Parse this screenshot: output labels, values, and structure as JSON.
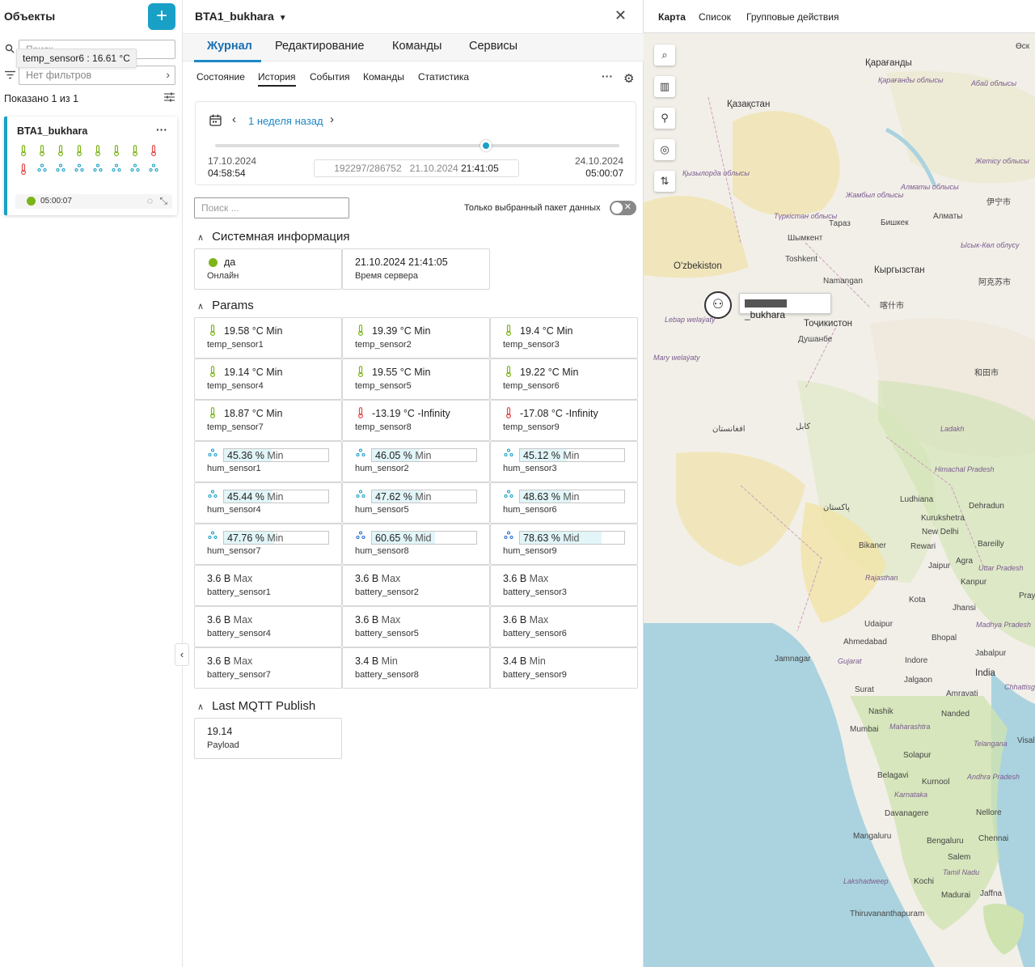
{
  "left": {
    "title": "Объекты",
    "add_label": "+",
    "search_placeholder": "Поиск",
    "tooltip": "temp_sensor6 : 16.61 °C",
    "filter_label": "Нет фильтров",
    "shown_text": "Показано 1 из 1",
    "card": {
      "title": "BTA1_bukhara",
      "more": "···",
      "row1": [
        {
          "icon": "thermometer-icon",
          "status": "ok"
        },
        {
          "icon": "thermometer-icon",
          "status": "ok"
        },
        {
          "icon": "thermometer-icon",
          "status": "ok"
        },
        {
          "icon": "thermometer-icon",
          "status": "ok"
        },
        {
          "icon": "thermometer-icon",
          "status": "ok"
        },
        {
          "icon": "thermometer-icon",
          "status": "ok"
        },
        {
          "icon": "thermometer-icon",
          "status": "ok"
        },
        {
          "icon": "thermometer-icon",
          "status": "alert"
        }
      ],
      "row2": [
        {
          "icon": "thermometer-icon",
          "status": "alert"
        },
        {
          "icon": "humidity-icon",
          "status": "ok"
        },
        {
          "icon": "humidity-icon",
          "status": "ok"
        },
        {
          "icon": "humidity-icon",
          "status": "ok"
        },
        {
          "icon": "humidity-icon",
          "status": "ok"
        },
        {
          "icon": "humidity-icon",
          "status": "ok"
        },
        {
          "icon": "humidity-icon",
          "status": "ok"
        },
        {
          "icon": "humidity-icon",
          "status": "ok"
        }
      ],
      "time": "05:00:07"
    }
  },
  "mid": {
    "title": "BTA1_bukhara",
    "tabs": [
      "Журнал",
      "Редактирование",
      "Команды",
      "Сервисы"
    ],
    "active_tab": "Журнал",
    "subtabs": [
      "Состояние",
      "История",
      "События",
      "Команды",
      "Статистика"
    ],
    "active_subtab": "История",
    "period": {
      "label": "1 неделя назад",
      "start_date": "17.10.2024",
      "start_time": "04:58:54",
      "end_date": "24.10.2024",
      "end_time": "05:00:07",
      "counter": "192297/286752",
      "current_date": "21.10.2024",
      "current_time": "21:41:05",
      "slider_position": 0.67
    },
    "search_placeholder": "Поиск ...",
    "only_selected_label": "Только выбранный пакет данных",
    "sections": {
      "system": {
        "title": "Системная информация",
        "cells": [
          {
            "value": "да",
            "name": "Онлайн"
          },
          {
            "value": "21.10.2024 21:41:05",
            "name": "Время сервера"
          }
        ]
      },
      "params": {
        "title": "Params",
        "temps": [
          {
            "value": "19.58 °C",
            "tag": "Min",
            "name": "temp_sensor1",
            "status": "ok"
          },
          {
            "value": "19.39 °C",
            "tag": "Min",
            "name": "temp_sensor2",
            "status": "ok"
          },
          {
            "value": "19.4 °C",
            "tag": "Min",
            "name": "temp_sensor3",
            "status": "ok"
          },
          {
            "value": "19.14 °C",
            "tag": "Min",
            "name": "temp_sensor4",
            "status": "ok"
          },
          {
            "value": "19.55 °C",
            "tag": "Min",
            "name": "temp_sensor5",
            "status": "ok"
          },
          {
            "value": "19.22 °C",
            "tag": "Min",
            "name": "temp_sensor6",
            "status": "ok"
          },
          {
            "value": "18.87 °C",
            "tag": "Min",
            "name": "temp_sensor7",
            "status": "ok"
          },
          {
            "value": "-13.19 °C",
            "tag": "-Infinity",
            "name": "temp_sensor8",
            "status": "alert"
          },
          {
            "value": "-17.08 °C",
            "tag": "-Infinity",
            "name": "temp_sensor9",
            "status": "alert"
          }
        ],
        "hums": [
          {
            "value": "45.36 %",
            "tag": "Min",
            "name": "hum_sensor1",
            "level": 0.4536,
            "color": "#19a0c6"
          },
          {
            "value": "46.05 %",
            "tag": "Min",
            "name": "hum_sensor2",
            "level": 0.4605,
            "color": "#19a0c6"
          },
          {
            "value": "45.12 %",
            "tag": "Min",
            "name": "hum_sensor3",
            "level": 0.4512,
            "color": "#19a0c6"
          },
          {
            "value": "45.44 %",
            "tag": "Min",
            "name": "hum_sensor4",
            "level": 0.4544,
            "color": "#19a0c6"
          },
          {
            "value": "47.62 %",
            "tag": "Min",
            "name": "hum_sensor5",
            "level": 0.4762,
            "color": "#19a0c6"
          },
          {
            "value": "48.63 %",
            "tag": "Min",
            "name": "hum_sensor6",
            "level": 0.4863,
            "color": "#19a0c6"
          },
          {
            "value": "47.76 %",
            "tag": "Min",
            "name": "hum_sensor7",
            "level": 0.4776,
            "color": "#19a0c6"
          },
          {
            "value": "60.65 %",
            "tag": "Mid",
            "name": "hum_sensor8",
            "level": 0.6065,
            "color": "#2a6fd0"
          },
          {
            "value": "78.63 %",
            "tag": "Mid",
            "name": "hum_sensor9",
            "level": 0.7863,
            "color": "#2a6fd0"
          }
        ],
        "batteries": [
          {
            "value": "3.6 В",
            "tag": "Max",
            "name": "battery_sensor1"
          },
          {
            "value": "3.6 В",
            "tag": "Max",
            "name": "battery_sensor2"
          },
          {
            "value": "3.6 В",
            "tag": "Max",
            "name": "battery_sensor3"
          },
          {
            "value": "3.6 В",
            "tag": "Max",
            "name": "battery_sensor4"
          },
          {
            "value": "3.6 В",
            "tag": "Max",
            "name": "battery_sensor5"
          },
          {
            "value": "3.6 В",
            "tag": "Max",
            "name": "battery_sensor6"
          },
          {
            "value": "3.6 В",
            "tag": "Max",
            "name": "battery_sensor7"
          },
          {
            "value": "3.4 В",
            "tag": "Min",
            "name": "battery_sensor8"
          },
          {
            "value": "3.4 В",
            "tag": "Min",
            "name": "battery_sensor9"
          }
        ]
      },
      "mqtt": {
        "title": "Last MQTT Publish",
        "cells": [
          {
            "value": "19.14",
            "name": "Payload"
          }
        ]
      }
    }
  },
  "map": {
    "tabs": [
      "Карта",
      "Список",
      "Групповые действия"
    ],
    "active_tab": "Карта",
    "controls": [
      "search-icon",
      "map-icon",
      "pin-icon",
      "locate-icon",
      "route-icon"
    ],
    "marker_label_suffix": "_bukhara",
    "places": [
      {
        "text": "Қарағанды"
      },
      {
        "text": "Қазақстан"
      },
      {
        "text": "Қарағанды облысы"
      },
      {
        "text": "Абай облысы"
      },
      {
        "text": "Жетісу облысы"
      },
      {
        "text": "Қызылорда облысы"
      },
      {
        "text": "Жамбыл облысы"
      },
      {
        "text": "Алматы облысы"
      },
      {
        "text": "Түркістан облысы"
      },
      {
        "text": "Тараз"
      },
      {
        "text": "Бишкек"
      },
      {
        "text": "Алматы"
      },
      {
        "text": "Шымкент"
      },
      {
        "text": "Ысык-Көл облусу"
      },
      {
        "text": "Toshkent"
      },
      {
        "text": "O'zbekiston"
      },
      {
        "text": "Namangan"
      },
      {
        "text": "Кыргызстан"
      },
      {
        "text": "阿克苏市"
      },
      {
        "text": "Тоҷикистон"
      },
      {
        "text": "Душанбе"
      },
      {
        "text": "Lebap welaýaty"
      },
      {
        "text": "Mary welaýaty"
      },
      {
        "text": "喀什市"
      },
      {
        "text": "和田市"
      },
      {
        "text": "افغانستان"
      },
      {
        "text": "کابل"
      },
      {
        "text": "Ladakh"
      },
      {
        "text": "Himachal Pradesh"
      },
      {
        "text": "Ludhiana"
      },
      {
        "text": "Kurukshetra"
      },
      {
        "text": "Dehradun"
      },
      {
        "text": "New Delhi"
      },
      {
        "text": "پاکستان"
      },
      {
        "text": "Bikaner"
      },
      {
        "text": "Rewari"
      },
      {
        "text": "Bareilly"
      },
      {
        "text": "Agra"
      },
      {
        "text": "Jaipur"
      },
      {
        "text": "Uttar Pradesh"
      },
      {
        "text": "Rajasthan"
      },
      {
        "text": "Kanpur"
      },
      {
        "text": "Prayagr"
      },
      {
        "text": "Kota"
      },
      {
        "text": "Jhansi"
      },
      {
        "text": "Udaipur"
      },
      {
        "text": "Madhya Pradesh"
      },
      {
        "text": "Ahmedabad"
      },
      {
        "text": "Bhopal"
      },
      {
        "text": "Jamnagar"
      },
      {
        "text": "Gujarat"
      },
      {
        "text": "Indore"
      },
      {
        "text": "Jabalpur"
      },
      {
        "text": "India"
      },
      {
        "text": "Jalgaon"
      },
      {
        "text": "Chhattisgar"
      },
      {
        "text": "Surat"
      },
      {
        "text": "Amravati"
      },
      {
        "text": "Nashik"
      },
      {
        "text": "Nanded"
      },
      {
        "text": "Mumbai"
      },
      {
        "text": "Maharashtra"
      },
      {
        "text": "Telangana"
      },
      {
        "text": "Visal"
      },
      {
        "text": "Solapur"
      },
      {
        "text": "Belagavi"
      },
      {
        "text": "Kurnool"
      },
      {
        "text": "Andhra Pradesh"
      },
      {
        "text": "Karnataka"
      },
      {
        "text": "Davanagere"
      },
      {
        "text": "Nellore"
      },
      {
        "text": "Mangaluru"
      },
      {
        "text": "Bengaluru"
      },
      {
        "text": "Chennai"
      },
      {
        "text": "Salem"
      },
      {
        "text": "Tamil Nadu"
      },
      {
        "text": "Lakshadweep"
      },
      {
        "text": "Kochi"
      },
      {
        "text": "Madurai"
      },
      {
        "text": "Jaffna"
      },
      {
        "text": "Thiruvananthapuram"
      },
      {
        "text": "伊宁市"
      },
      {
        "text": "Өск"
      }
    ]
  }
}
